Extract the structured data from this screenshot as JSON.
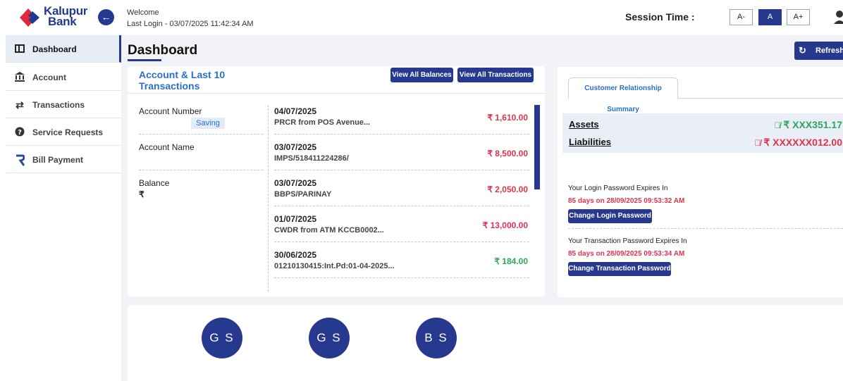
{
  "brand": {
    "name_line1": "Kalupur",
    "name_line2": "Bank"
  },
  "header": {
    "welcome": "Welcome",
    "last_login": "Last Login - 03/07/2025 11:42:34 AM",
    "session_label": "Session Time :",
    "font_sizes": [
      "A-",
      "A",
      "A+"
    ]
  },
  "sidebar": {
    "items": [
      {
        "label": "Dashboard",
        "icon": "dashboard-icon"
      },
      {
        "label": "Account",
        "icon": "bank-icon"
      },
      {
        "label": "Transactions",
        "icon": "transfer-icon"
      },
      {
        "label": "Service Requests",
        "icon": "help-icon"
      },
      {
        "label": "Bill Payment",
        "icon": "bill-icon"
      }
    ]
  },
  "main": {
    "title": "Dashboard",
    "refresh_label": "Refresh",
    "account_card": {
      "title": "Account & Last 10 Transactions",
      "view_balances": "View All Balances",
      "view_transactions": "View All Transactions",
      "account_number_label": "Account Number",
      "account_type": "Saving",
      "account_name_label": "Account Name",
      "balance_label": "Balance",
      "balance_currency": "₹",
      "transactions": [
        {
          "date": "04/07/2025",
          "desc": "PRCR from POS Avenue...",
          "amount": "₹ 1,610.00",
          "kind": "debit"
        },
        {
          "date": "03/07/2025",
          "desc": "IMPS/518411224286/",
          "amount": "₹ 8,500.00",
          "kind": "debit"
        },
        {
          "date": "03/07/2025",
          "desc": "BBPS/PARINAY",
          "amount": "₹ 2,050.00",
          "kind": "debit"
        },
        {
          "date": "01/07/2025",
          "desc": "CWDR from ATM KCCB0002...",
          "amount": "₹ 13,000.00",
          "kind": "debit"
        },
        {
          "date": "30/06/2025",
          "desc": "01210130415:Int.Pd:01-04-2025...",
          "amount": "₹ 184.00",
          "kind": "credit"
        }
      ]
    },
    "relationship_card": {
      "tab": "Customer Relationship Summary",
      "assets_label": "Assets",
      "assets_value": "₹ XXX351.17",
      "liabilities_label": "Liabilities",
      "liabilities_value": "₹ XXXXXX012.00",
      "login_pw_label": "Your Login Password Expires In",
      "login_pw_expiry": "85 days on 28/09/2025 09:53:32 AM",
      "change_login_pw": "Change Login Password",
      "txn_pw_label": "Your Transaction Password Expires In",
      "txn_pw_expiry": "85 days on 28/09/2025 09:53:34 AM",
      "change_txn_pw": "Change Transaction Password"
    },
    "avatars": [
      "G S",
      "G S",
      "B S"
    ]
  },
  "colors": {
    "primary": "#27388f",
    "link_blue": "#2a6fc9",
    "debit": "#e0334e",
    "credit": "#2aa75a"
  }
}
